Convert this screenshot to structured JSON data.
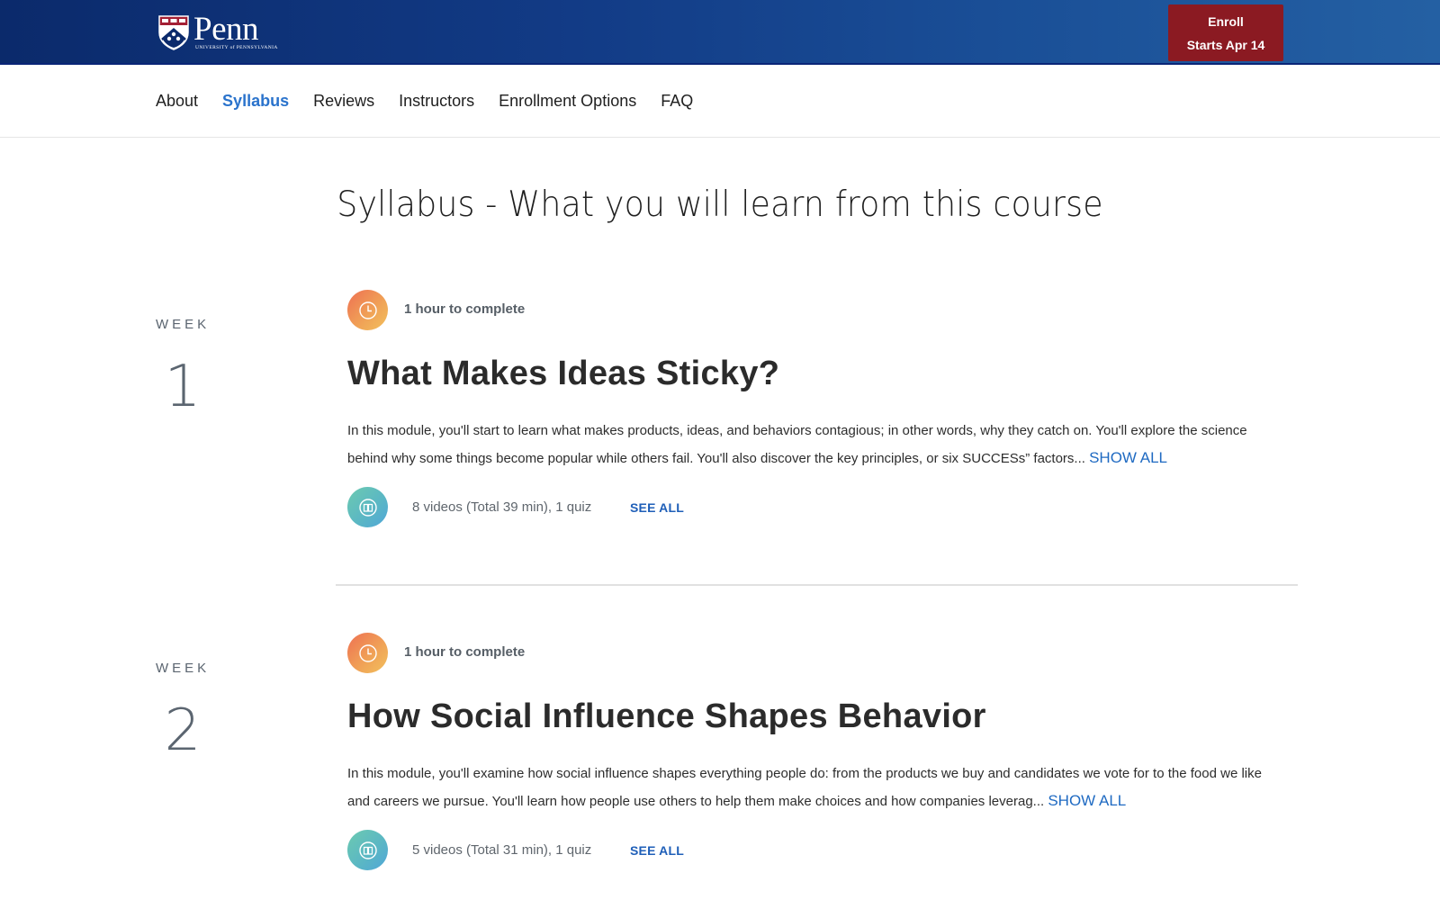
{
  "header": {
    "logo": {
      "wordmark": "Penn",
      "subtitle": "UNIVERSITY of PENNSYLVANIA"
    },
    "enroll_button": {
      "line1": "Enroll",
      "line2": "Starts Apr 14",
      "color": "#8b1a22"
    },
    "brand_color": "#0b2a6b"
  },
  "nav": {
    "items": [
      {
        "label": "About",
        "active": false
      },
      {
        "label": "Syllabus",
        "active": true
      },
      {
        "label": "Reviews",
        "active": false
      },
      {
        "label": "Instructors",
        "active": false
      },
      {
        "label": "Enrollment Options",
        "active": false
      },
      {
        "label": "FAQ",
        "active": false
      }
    ],
    "active_color": "#2a73cc"
  },
  "page_title": "Syllabus - What you will learn from this course",
  "weeks": [
    {
      "week_label": "WEEK",
      "week_number": "1",
      "duration_icon": "clock-icon",
      "duration": "1 hour to complete",
      "title": "What Makes Ideas Sticky?",
      "description": "In this module, you'll start to learn what makes products, ideas, and behaviors contagious; in other words, why they catch on. You'll explore the science behind why some things become popular while others fail. You'll also discover the key principles, or six SUCCESs” factors...",
      "show_all": "SHOW ALL",
      "content_icon": "book-icon",
      "content_summary": "8 videos (Total 39 min), 1 quiz",
      "see_all": "SEE ALL"
    },
    {
      "week_label": "WEEK",
      "week_number": "2",
      "duration_icon": "clock-icon",
      "duration": "1 hour to complete",
      "title": "How Social Influence Shapes Behavior",
      "description": "In this module, you'll examine how social influence shapes everything people do: from the products we buy and candidates we vote for to the food we like and careers we pursue. You'll learn how people use others to help them make choices and how companies leverag...",
      "show_all": "SHOW ALL",
      "content_icon": "book-icon",
      "content_summary": "5 videos (Total 31 min), 1 quiz",
      "see_all": "SEE ALL"
    }
  ]
}
